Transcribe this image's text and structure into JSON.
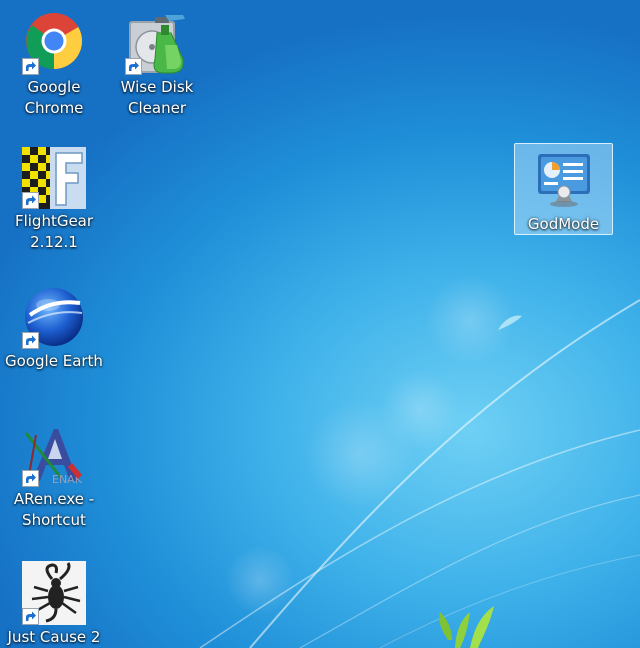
{
  "desktop": {
    "icons": [
      {
        "label": "Google\nChrome",
        "icon": "chrome-icon",
        "shortcut": true
      },
      {
        "label": "Wise Disk\nCleaner",
        "icon": "wise-disk-cleaner-icon",
        "shortcut": true
      },
      {
        "label": "FlightGear\n2.12.1",
        "icon": "flightgear-icon",
        "shortcut": true
      },
      {
        "label": "GodMode",
        "icon": "control-panel-icon",
        "shortcut": false,
        "selected": true
      },
      {
        "label": "Google Earth",
        "icon": "google-earth-icon",
        "shortcut": true
      },
      {
        "label": "ARen.exe -\nShortcut",
        "icon": "aren-icon",
        "shortcut": true
      },
      {
        "label": "Just Cause 2",
        "icon": "just-cause-2-icon",
        "shortcut": true
      }
    ]
  },
  "colors": {
    "background_dark": "#1670c4",
    "background_light": "#6fd0f4",
    "selection": "#c8e6ff"
  }
}
